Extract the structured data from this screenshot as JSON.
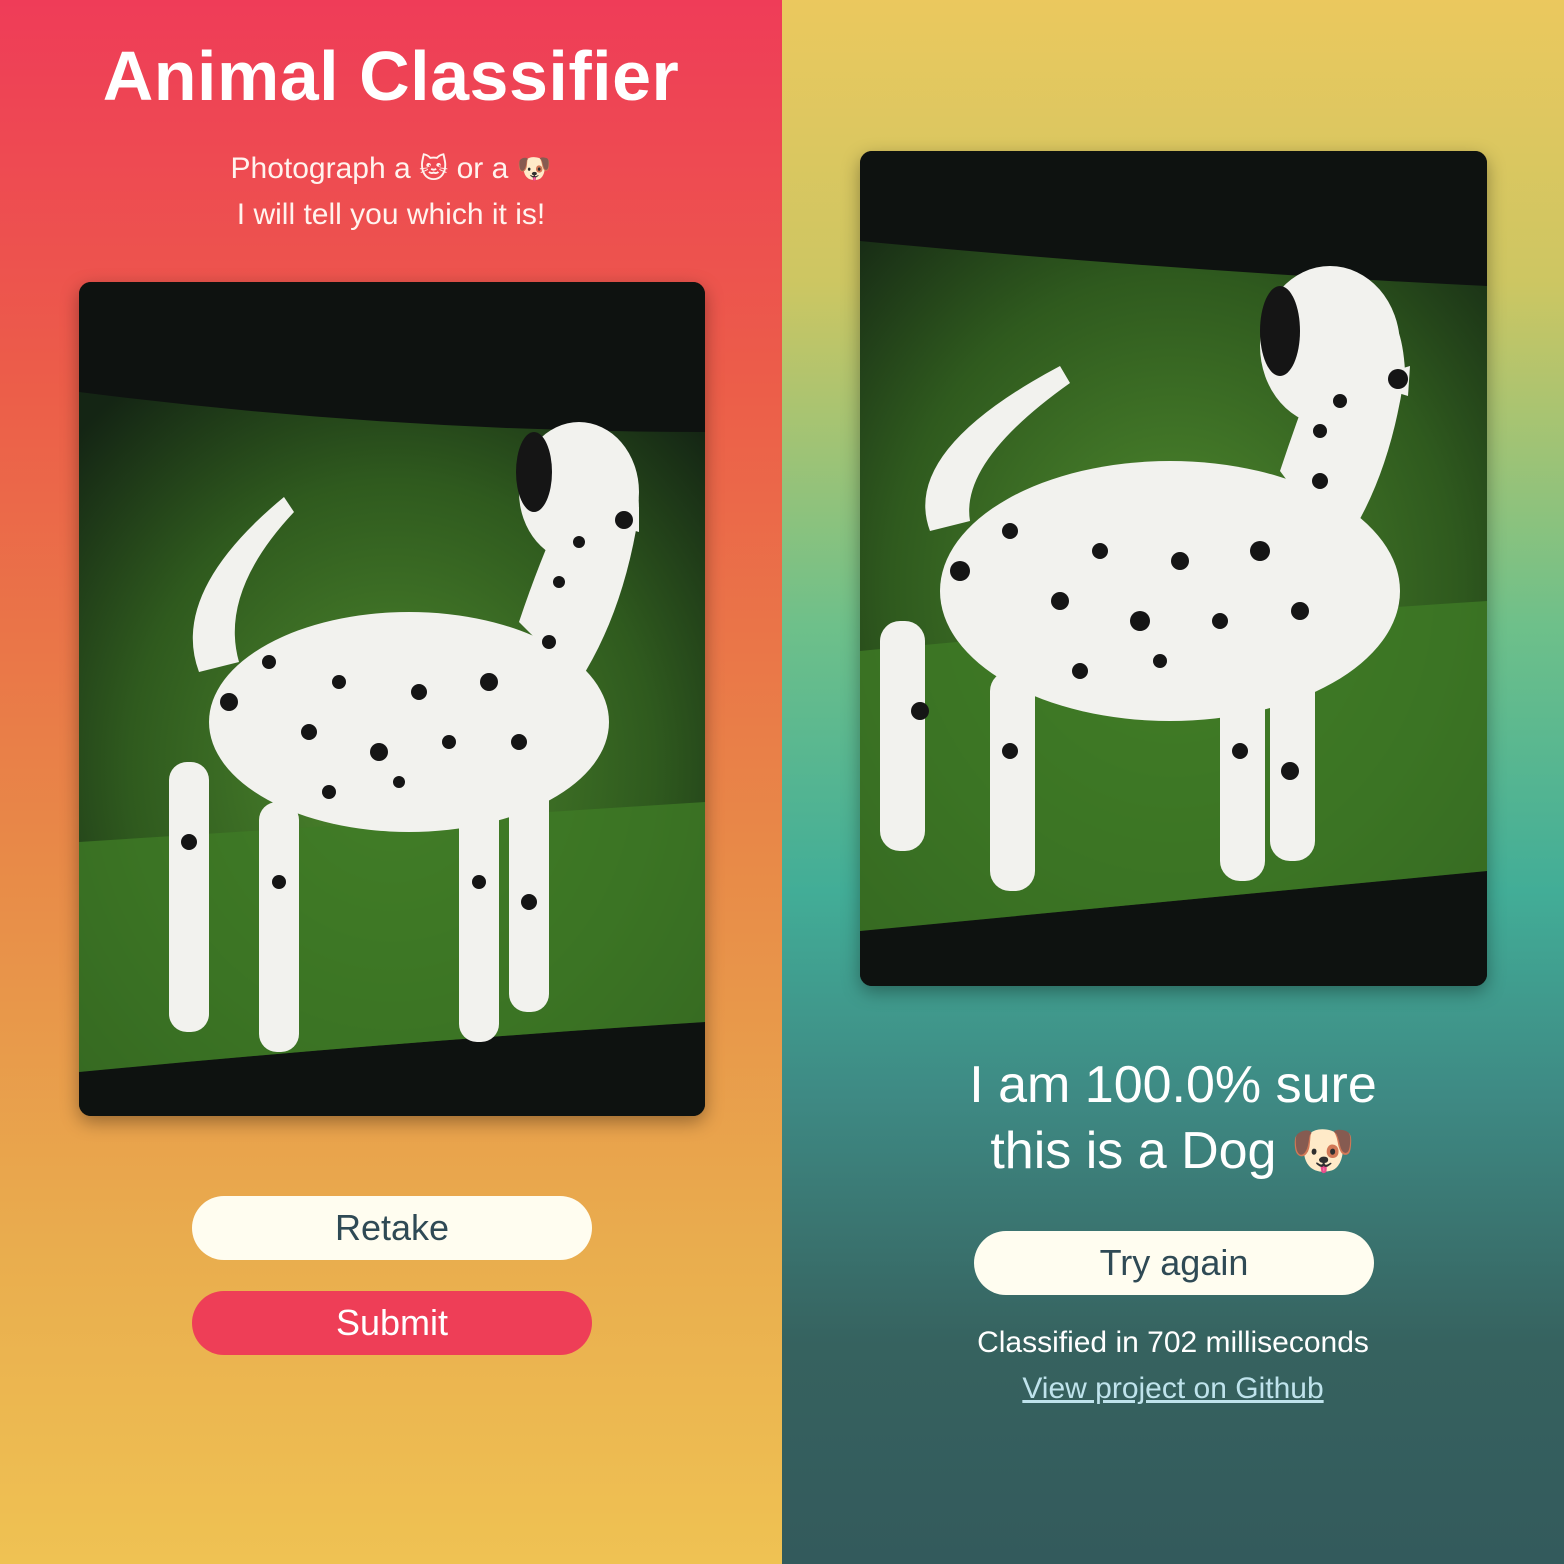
{
  "left_screen": {
    "title": "Animal Classifier",
    "subtitle_line1_prefix": "Photograph a",
    "subtitle_cat_emoji": "🐱",
    "subtitle_line1_middle": "or a",
    "subtitle_dog_emoji": "🐶",
    "subtitle_line2": "I will tell you which it is!",
    "retake_label": "Retake",
    "submit_label": "Submit"
  },
  "right_screen": {
    "result_line1": "I am 100.0% sure",
    "result_line2_prefix": "this is a Dog",
    "result_emoji": "🐶",
    "try_again_label": "Try again",
    "timing_text": "Classified in 702 milliseconds",
    "github_link_text": "View project on Github"
  },
  "colors": {
    "accent_red": "#ee3e57",
    "button_light": "#fffdf0",
    "button_text_dark": "#2f4a55",
    "link_color": "#bfe3ec"
  },
  "icons": [
    "cat-face-emoji",
    "dog-face-emoji"
  ]
}
